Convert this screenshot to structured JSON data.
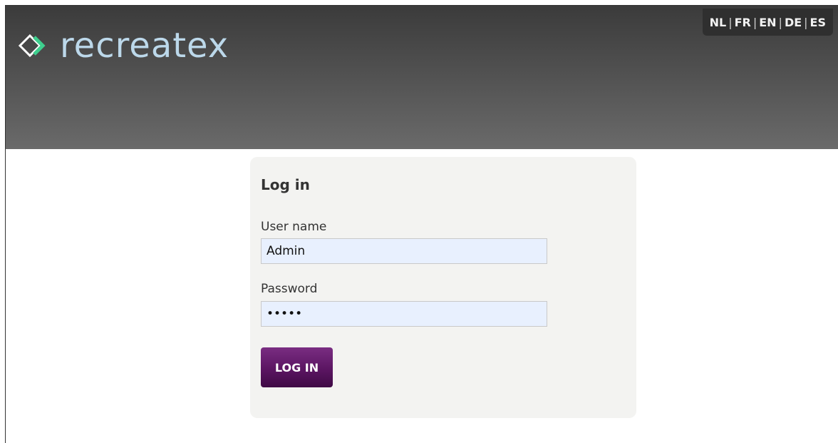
{
  "header": {
    "logo_text": "recreatex",
    "logo_icon": "diamond-chevron-logo",
    "brand_color": "#bcd8ea",
    "languages": [
      {
        "code": "NL"
      },
      {
        "code": "FR"
      },
      {
        "code": "EN"
      },
      {
        "code": "DE"
      },
      {
        "code": "ES"
      }
    ]
  },
  "login": {
    "title": "Log in",
    "username_label": "User name",
    "username_value": "Admin",
    "password_label": "Password",
    "password_value": "•••••",
    "submit_label": "LOG IN",
    "button_color": "#5b1562"
  }
}
